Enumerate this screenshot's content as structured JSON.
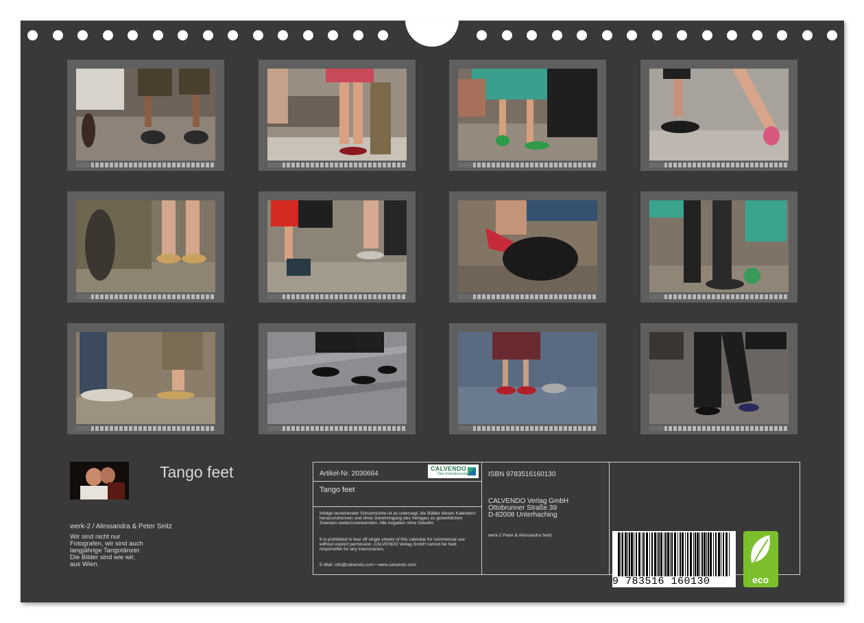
{
  "calendar": {
    "title": "Tango feet",
    "author": "werk-2 / Alessandra & Peter Seitz",
    "bio_lines": [
      "Wir sind nicht nur",
      "Fotografen, wir sind auch",
      "langjährige Tangotänzer.",
      "Die Bilder sind wie wir,",
      "aus Wien."
    ]
  },
  "publisher_box": {
    "article_no": "Artikel-Nr. 2030664",
    "logo_text": "CALVENDO",
    "logo_sub": "Dein Kalenderverlag",
    "title": "Tango feet",
    "legal_de": "Infolge bestehender Schutzrechte ist es untersagt, die Blätter dieses Kalenders herauszutrennen und ohne Genehmigung des Verlages zu gewerblichen Zwecken weiterzuverwenden. Alle Angaben ohne Gewähr.",
    "legal_en": "It is prohibited to tear off single sheets of this calendar for commercial use without explicit permission. CALVENDO Verlag GmbH cannot be held responsible for any inaccuracies.",
    "contact": "E-Mail: info@calvendo.com • www.calvendo.com",
    "isbn": "ISBN 9783516160130",
    "publisher_lines": [
      "CALVENDO Verlag GmbH",
      "Ottobrunner Straße 39",
      "D-82008 Unterhaching"
    ],
    "credit": "werk-2 Peter & Alessandra Seitz",
    "barcode_digits": "9 783516 160130",
    "eco_label": "eco"
  }
}
